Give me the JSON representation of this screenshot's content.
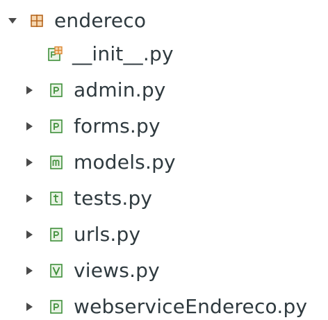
{
  "tree": {
    "root": {
      "label": "endereco",
      "icon": "package-icon",
      "expanded": true
    },
    "children": [
      {
        "label": "__init__.py",
        "icon": "init-python-file-icon",
        "expandable": false
      },
      {
        "label": "admin.py",
        "icon": "python-file-icon",
        "expandable": true
      },
      {
        "label": "forms.py",
        "icon": "python-file-icon",
        "expandable": true
      },
      {
        "label": "models.py",
        "icon": "models-file-icon",
        "expandable": true
      },
      {
        "label": "tests.py",
        "icon": "tests-file-icon",
        "expandable": true
      },
      {
        "label": "urls.py",
        "icon": "python-file-icon",
        "expandable": true
      },
      {
        "label": "views.py",
        "icon": "views-file-icon",
        "expandable": true
      },
      {
        "label": "webserviceEndereco.py",
        "icon": "python-file-icon",
        "expandable": true
      }
    ]
  },
  "colors": {
    "text": "#2f3a3f",
    "twisty": "#4a4a4a",
    "package_icon": "#b5651d",
    "file_icon_green": "#3f8f3a",
    "init_icon_orange": "#d9822b"
  }
}
